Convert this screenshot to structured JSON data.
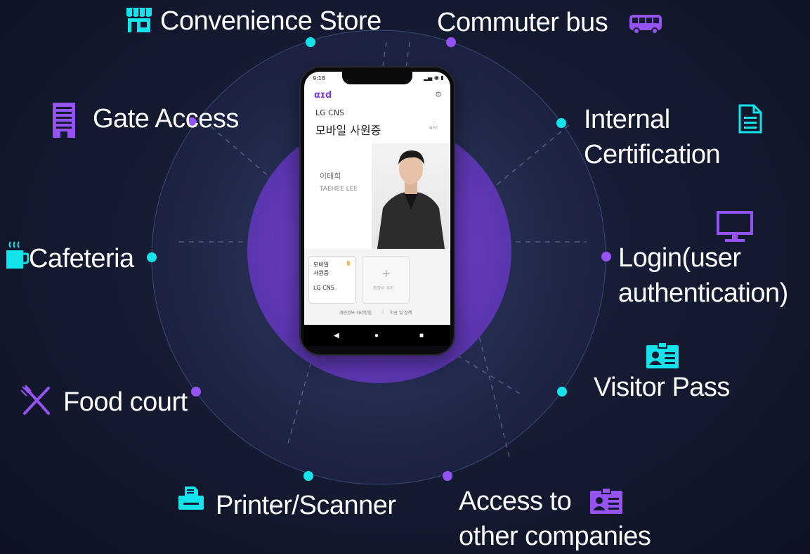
{
  "services": {
    "convenience_store": "Convenience Store",
    "commuter_bus": "Commuter bus",
    "gate_access": "Gate Access",
    "internal_certification": [
      "Internal",
      "Certification"
    ],
    "cafeteria": "Cafeteria",
    "login": [
      "Login(user",
      "authentication)"
    ],
    "visitor_pass": "Visitor Pass",
    "food_court": "Food court",
    "printer_scanner": "Printer/Scanner",
    "access_other": [
      "Access to",
      "other companies"
    ]
  },
  "phone": {
    "status_time": "9:18",
    "app_logo": "αɪd",
    "company": "LG CNS",
    "card_title": "모바일 사원증",
    "nfc_label": "NFC",
    "name_korean": "이태희",
    "name_english": "TAEHEE LEE",
    "mini_card_title_line1": "모바일",
    "mini_card_title_line2": "사원증",
    "mini_card_company": "LG CNS",
    "add_card_label": "증명서 추가",
    "footer_privacy": "개인정보 처리방침",
    "footer_separator": "|",
    "footer_terms": "약관 및 정책"
  },
  "colors": {
    "background": "#141a30",
    "ring": "#232b4e",
    "inner_circle": "#6a3fc0",
    "cyan_accent": "#14e3ec",
    "purple_accent": "#9553f3"
  },
  "icons": {
    "convenience_store": "store-icon",
    "commuter_bus": "bus-icon",
    "gate_access": "building-icon",
    "internal_certification": "document-icon",
    "cafeteria": "coffee-cup-icon",
    "login": "monitor-icon",
    "visitor_pass": "id-card-icon",
    "food_court": "utensils-icon",
    "printer_scanner": "printer-icon",
    "access_other": "id-card-icon"
  }
}
